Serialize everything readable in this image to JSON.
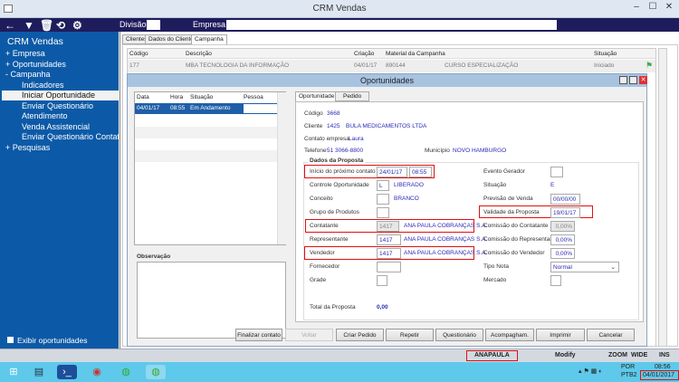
{
  "app": {
    "title": "CRM Vendas"
  },
  "toolbar": {
    "divisao_label": "Divisão",
    "divisao_value": "",
    "empresa_label": "Empresa",
    "empresa_value": ""
  },
  "sidebar": {
    "title": "CRM Vendas",
    "items": [
      {
        "label": "Empresa",
        "expander": "+"
      },
      {
        "label": "Oportunidades",
        "expander": "+"
      },
      {
        "label": "Campanha",
        "expander": "-"
      }
    ],
    "sub_items": [
      "Indicadores",
      "Iniciar Oportunidade",
      "Enviar Questionário",
      "Atendimento",
      "Venda Assistencial",
      "Enviar Questionário Contato"
    ],
    "selected": "Iniciar Oportunidade",
    "after_items": [
      {
        "label": "Pesquisas",
        "expander": "+"
      }
    ],
    "checkbox_label": "Exibir oportunidades"
  },
  "main": {
    "tabs": [
      "Clientes",
      "Dados do Cliente",
      "Campanha"
    ],
    "active_tab": "Campanha",
    "columns": [
      "Código",
      "Descrição",
      "Criação",
      "Material da Campanha",
      "Situação"
    ],
    "rows": [
      {
        "codigo": "177",
        "descricao": "MBA TECNOLOGIA DA INFORMAÇÃO",
        "criacao": "04/01/17",
        "material_cod": "890144",
        "material": "CURSO ESPECIALIZAÇÃO",
        "situacao": "Iniciado"
      }
    ]
  },
  "dialog": {
    "title": "Oportunidades",
    "list_columns": [
      "Data",
      "Hora",
      "Situação",
      "Pessoa"
    ],
    "list_rows": [
      {
        "data": "04/01/17",
        "hora": "08:55",
        "situacao": "Em Andamento",
        "pessoa": ""
      }
    ],
    "observacao_label": "Observação",
    "tabs": [
      "Oportunidade",
      "Pedido"
    ],
    "active_tab": "Oportunidade",
    "codigo_label": "Código",
    "codigo": "3668",
    "cliente_label": "Cliente",
    "cliente_cod": "1425",
    "cliente_nome": "BULA MEDICAMENTOS LTDA",
    "contato_label": "Contato empresa",
    "contato": "Laura",
    "telefone_label": "Telefone",
    "telefone": "51 3066-8800",
    "municipio_label": "Município",
    "municipio": "NOVO HAMBURGO",
    "proposta": {
      "legend": "Dados da Proposta",
      "inicio_label": "Início do próximo contato",
      "inicio_data": "24/01/17",
      "inicio_hora": "08:55",
      "controle_label": "Controle Oportunidade",
      "controle_cod": "L",
      "controle": "LIBERADO",
      "conceito_label": "Conceito",
      "conceito": "BRANCO",
      "grupo_label": "Grupo de Produtos",
      "contatante_label": "Contatante",
      "contatante_cod": "1417",
      "contatante": "ANA PAULA COBRANÇAS S.A.",
      "representante_label": "Representante",
      "representante_cod": "1417",
      "representante": "ANA PAULA COBRANÇAS S.A.",
      "vendedor_label": "Vendedor",
      "vendedor_cod": "1417",
      "vendedor": "ANA PAULA COBRANÇAS S.A.",
      "fornecedor_label": "Fornecedor",
      "grade_label": "Grade",
      "evento_label": "Evento Gerador",
      "situacao_label": "Situação",
      "situacao": "E",
      "previsao_label": "Previsão de Venda",
      "previsao": "00/00/00",
      "validade_label": "Validade da Proposta",
      "validade": "19/01/17",
      "com_contatante_label": "Comissão do Contatante",
      "com_contatante": "0,00%",
      "com_representante_label": "Comissão do Representante",
      "com_representante": "0,00%",
      "com_vendedor_label": "Comissão do Vendedor",
      "com_vendedor": "0,00%",
      "tipo_nota_label": "Tipo Nota",
      "tipo_nota": "Normal",
      "mercado_label": "Mercado",
      "total_label": "Total da Proposta",
      "total": "0,00"
    },
    "buttons": [
      "Finalizar contato",
      "Voltar",
      "Criar Pedido",
      "Repetir",
      "Questionário",
      "Acompagham.",
      "Imprimir",
      "Cancelar"
    ]
  },
  "status": {
    "user": "ANAPAULA",
    "mode": "Modify",
    "zoom": "ZOOM",
    "wide": "WIDE",
    "ins": "INS"
  },
  "taskbar": {
    "lang1": "POR",
    "lang2": "PTB2",
    "time": "08:56",
    "date": "04/01/2017"
  }
}
